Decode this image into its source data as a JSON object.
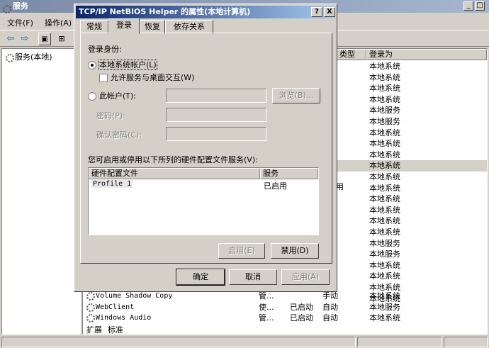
{
  "main": {
    "title": "服务",
    "menu": [
      "文件(F)",
      "操作(A)"
    ],
    "tree_item": "服务(本地)",
    "columns": {
      "type": "类型",
      "logon": "登录为"
    },
    "logon_values": [
      "本地系统",
      "本地系统",
      "本地系统",
      "本地系统",
      "本地服务",
      "本地服务",
      "本地系统",
      "本地系统",
      "本地系统",
      "本地系统",
      "本地系统",
      "本地系统",
      "本地系统",
      "本地系统",
      "本地系统",
      "本地系统",
      "本地服务",
      "本地服务",
      "本地系统",
      "本地系统",
      "本地系统",
      "本地系统"
    ],
    "partial_type_value": "用",
    "bottom_rows": [
      {
        "name": "Volume Shadow Copy",
        "desc": "管...",
        "status": "",
        "startup": "手动",
        "logon": "本地系统"
      },
      {
        "name": "WebClient",
        "desc": "使...",
        "status": "已启动",
        "startup": "自动",
        "logon": "本地服务"
      },
      {
        "name": "Windows Audio",
        "desc": "管...",
        "status": "已启动",
        "startup": "自动",
        "logon": "本地系统"
      }
    ],
    "bottom_tabs": [
      "扩展",
      "标准"
    ]
  },
  "dialog": {
    "title": "TCP/IP NetBIOS Helper 的属性(本地计算机)",
    "help_btn": "?",
    "close_btn": "X",
    "tabs": [
      "常规",
      "登录",
      "恢复",
      "依存关系"
    ],
    "logon_as_label": "登录身份:",
    "local_system_label": "本地系统帐户(L)",
    "interact_label": "允许服务与桌面交互(W)",
    "this_account_label": "此帐户(T):",
    "browse_btn": "浏览(B)...",
    "password_label": "密码(P):",
    "confirm_label": "确认密码(C):",
    "profile_caption": "您可启用或停用以下所列的硬件配置文件服务(V):",
    "profile_columns": [
      "硬件配置文件",
      "服务"
    ],
    "profile_rows": [
      {
        "profile": "Profile 1",
        "service": "已启用"
      }
    ],
    "enable_btn": "启用(E)",
    "disable_btn": "禁用(D)",
    "ok_btn": "确定",
    "cancel_btn": "取消",
    "apply_btn": "应用(A)"
  }
}
